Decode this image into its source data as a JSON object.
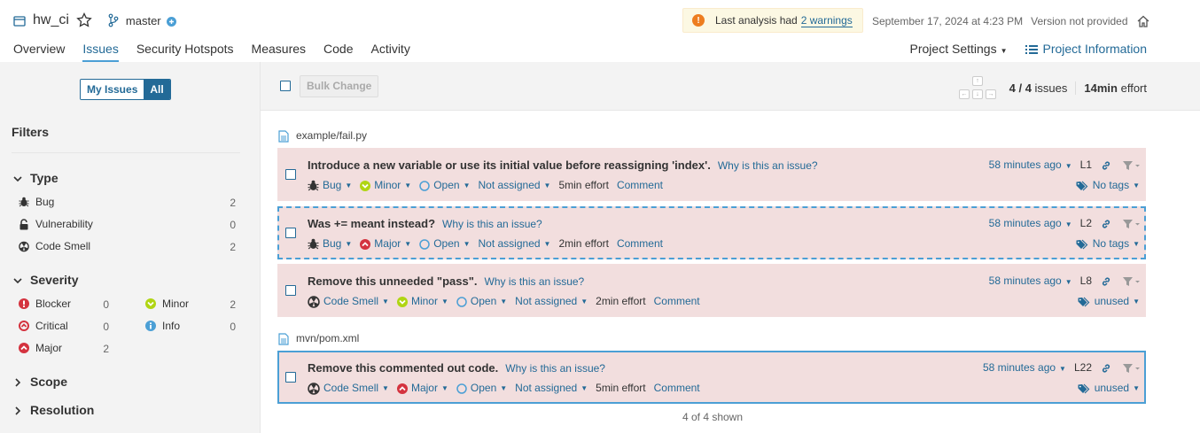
{
  "header": {
    "project_name": "hw_ci",
    "branch": "master",
    "warning_text": "Last analysis had",
    "warning_link": "2 warnings",
    "date": "September 17, 2024 at 4:23 PM",
    "version": "Version not provided"
  },
  "nav": {
    "tabs": [
      "Overview",
      "Issues",
      "Security Hotspots",
      "Measures",
      "Code",
      "Activity"
    ],
    "active_tab": "Issues",
    "project_settings": "Project Settings",
    "project_information": "Project Information"
  },
  "sidebar": {
    "toggle": {
      "my_issues": "My Issues",
      "all": "All",
      "selected": "All"
    },
    "filters_title": "Filters",
    "type": {
      "title": "Type",
      "items": [
        {
          "label": "Bug",
          "count": "2",
          "icon": "bug-icon"
        },
        {
          "label": "Vulnerability",
          "count": "0",
          "icon": "lock-icon"
        },
        {
          "label": "Code Smell",
          "count": "2",
          "icon": "code-smell-icon"
        }
      ]
    },
    "severity": {
      "title": "Severity",
      "items": [
        {
          "label": "Blocker",
          "count": "0",
          "icon": "blocker-icon"
        },
        {
          "label": "Minor",
          "count": "2",
          "icon": "minor-icon"
        },
        {
          "label": "Critical",
          "count": "0",
          "icon": "critical-icon"
        },
        {
          "label": "Info",
          "count": "0",
          "icon": "info-icon"
        },
        {
          "label": "Major",
          "count": "2",
          "icon": "major-icon"
        }
      ]
    },
    "scope": "Scope",
    "resolution": "Resolution"
  },
  "toolbar": {
    "bulk_change": "Bulk Change",
    "count": "4 / 4",
    "count_label": "issues",
    "effort": "14min",
    "effort_label": "effort"
  },
  "files": [
    {
      "path": "example/fail.py"
    },
    {
      "path": "mvn/pom.xml"
    }
  ],
  "issues": [
    {
      "message": "Introduce a new variable or use its initial value before reassigning 'index'.",
      "why": "Why is this an issue?",
      "type": "Bug",
      "severity": "Minor",
      "status": "Open",
      "assignee": "Not assigned",
      "effort": "5min effort",
      "comment": "Comment",
      "time": "58 minutes ago",
      "line": "L1",
      "tags": "No tags"
    },
    {
      "message": "Was += meant instead?",
      "why": "Why is this an issue?",
      "type": "Bug",
      "severity": "Major",
      "status": "Open",
      "assignee": "Not assigned",
      "effort": "2min effort",
      "comment": "Comment",
      "time": "58 minutes ago",
      "line": "L2",
      "tags": "No tags"
    },
    {
      "message": "Remove this unneeded \"pass\".",
      "why": "Why is this an issue?",
      "type": "Code Smell",
      "severity": "Minor",
      "status": "Open",
      "assignee": "Not assigned",
      "effort": "2min effort",
      "comment": "Comment",
      "time": "58 minutes ago",
      "line": "L8",
      "tags": "unused"
    },
    {
      "message": "Remove this commented out code.",
      "why": "Why is this an issue?",
      "type": "Code Smell",
      "severity": "Major",
      "status": "Open",
      "assignee": "Not assigned",
      "effort": "5min effort",
      "comment": "Comment",
      "time": "58 minutes ago",
      "line": "L22",
      "tags": "unused"
    }
  ],
  "footer": {
    "shown": "4 of 4 shown"
  },
  "colors": {
    "accent": "#236a97",
    "issue_bg": "#f2dede",
    "minor": "#b0d513",
    "major": "#d4333f",
    "warning": "#ed7d20"
  }
}
